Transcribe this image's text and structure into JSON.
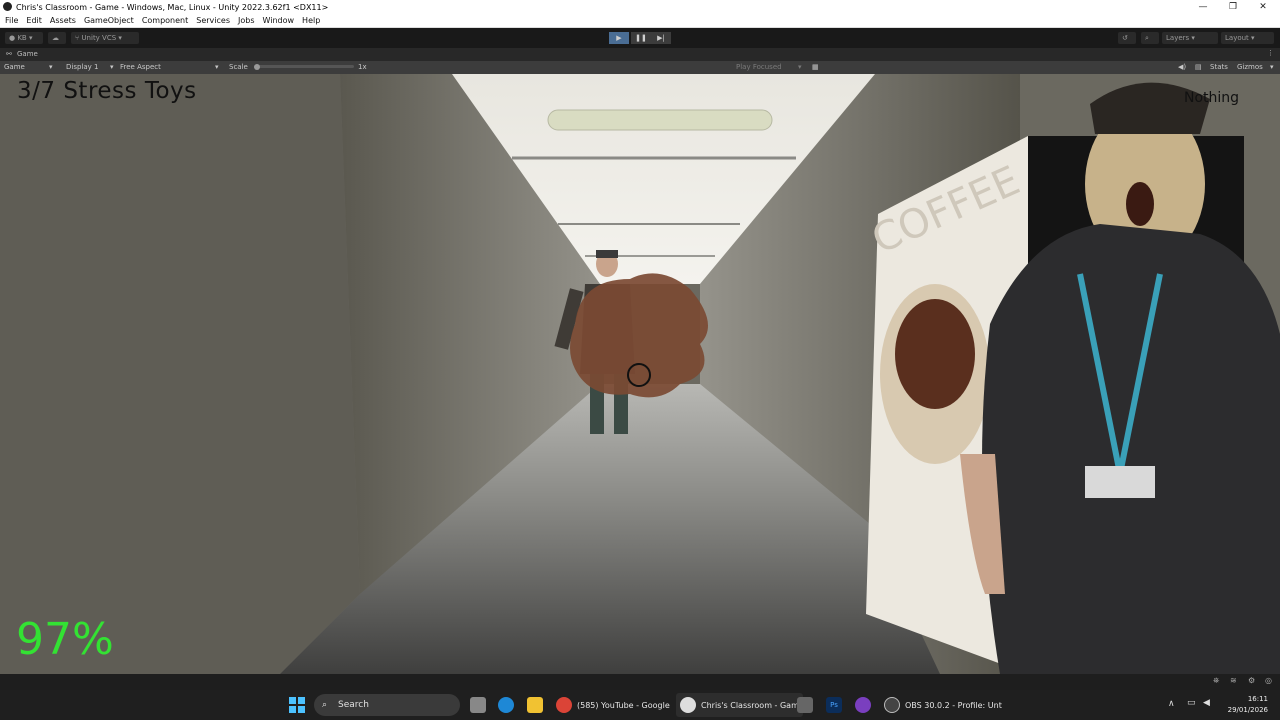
{
  "window": {
    "title": "Chris's Classroom - Game - Windows, Mac, Linux - Unity 2022.3.62f1 <DX11>",
    "minimize": "—",
    "maximize": "❐",
    "close": "✕"
  },
  "menu": [
    "File",
    "Edit",
    "Assets",
    "GameObject",
    "Component",
    "Services",
    "Jobs",
    "Window",
    "Help"
  ],
  "toolbar": {
    "account": "KB",
    "vcs": "Unity VCS",
    "layers": "Layers",
    "layout": "Layout"
  },
  "game_tab": {
    "label": "Game"
  },
  "game_bar": {
    "mode": "Game",
    "display": "Display 1",
    "aspect": "Free Aspect",
    "scale_label": "Scale",
    "scale_value": "1x",
    "play_focused": "Play Focused",
    "stats": "Stats",
    "gizmos": "Gizmos"
  },
  "hud": {
    "toys": "3/7 Stress Toys",
    "percent": "97%",
    "item": "Nothing",
    "poster_text": "COFFEE"
  },
  "taskbar": {
    "search": "Search",
    "apps": [
      {
        "label": "(585) YouTube - Google"
      },
      {
        "label": "Chris's Classroom - Gam"
      },
      {
        "label": "OBS 30.0.2 - Profile: Unt"
      }
    ],
    "time": "16:11",
    "date": "29/01/2026"
  },
  "colors": {
    "hud_percent": "#33e233",
    "editor_bg": "#191919",
    "play_active": "#4a90d9"
  }
}
